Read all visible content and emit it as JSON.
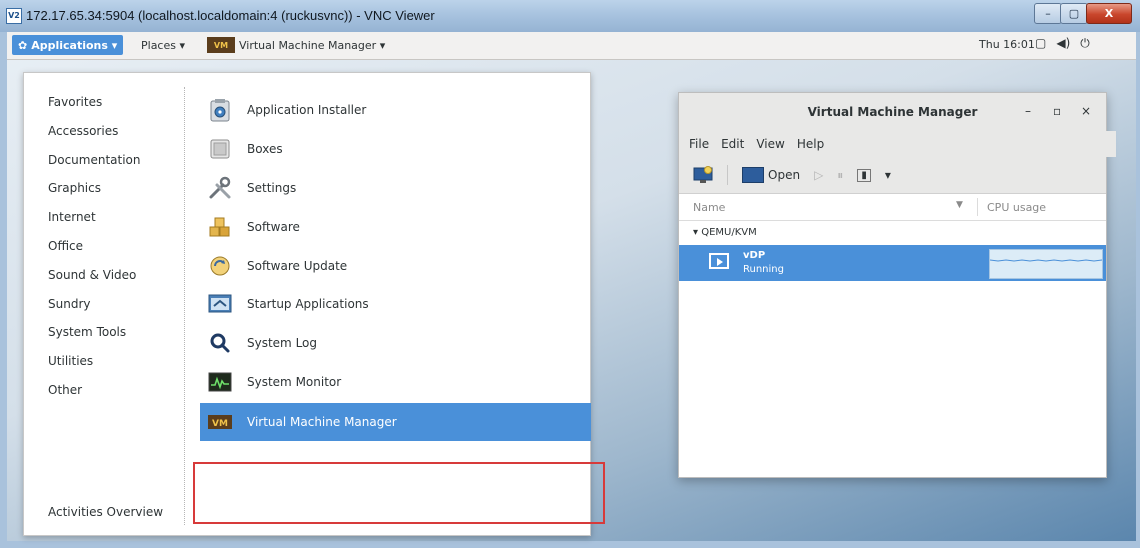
{
  "vnc": {
    "logo": "V2",
    "title": "172.17.65.34:5904 (localhost.localdomain:4 (ruckusvnc)) - VNC Viewer",
    "controls": {
      "minimize": "–",
      "maximize": "▢",
      "close": "X"
    }
  },
  "topbar": {
    "applications_label": "Applications ▾",
    "places_label": "Places ▾",
    "vmm_label": "Virtual Machine Manager ▾",
    "clock": "Thu 16:01",
    "status_icons": [
      "▢",
      "◀)",
      "⏻"
    ]
  },
  "apps_menu": {
    "categories": [
      "Favorites",
      "Accessories",
      "Documentation",
      "Graphics",
      "Internet",
      "Office",
      "Sound & Video",
      "Sundry",
      "System Tools",
      "Utilities",
      "Other"
    ],
    "activities_overview": "Activities Overview",
    "apps": [
      {
        "label": "Application Installer",
        "icon": "installer-icon"
      },
      {
        "label": "Boxes",
        "icon": "boxes-icon"
      },
      {
        "label": "Settings",
        "icon": "settings-icon"
      },
      {
        "label": "Software",
        "icon": "software-icon"
      },
      {
        "label": "Software Update",
        "icon": "software-update-icon"
      },
      {
        "label": "Startup Applications",
        "icon": "startup-icon"
      },
      {
        "label": "System Log",
        "icon": "system-log-icon"
      },
      {
        "label": "System Monitor",
        "icon": "system-monitor-icon"
      },
      {
        "label": "Virtual Machine Manager",
        "icon": "vmm-icon",
        "selected": true
      }
    ]
  },
  "vmm_window": {
    "title": "Virtual Machine Manager",
    "controls": {
      "minimize": "–",
      "maximize": "▫",
      "close": "×"
    },
    "menu": [
      "File",
      "Edit",
      "View",
      "Help"
    ],
    "toolbar": {
      "open_label": "Open"
    },
    "columns": {
      "name": "Name",
      "cpu": "CPU usage"
    },
    "group": "QEMU/KVM",
    "vm": {
      "name": "vDP",
      "status": "Running"
    }
  },
  "colors": {
    "selection": "#4a90d9",
    "highlight_box": "#d73a3a",
    "menu_bg": "#ffffff"
  }
}
